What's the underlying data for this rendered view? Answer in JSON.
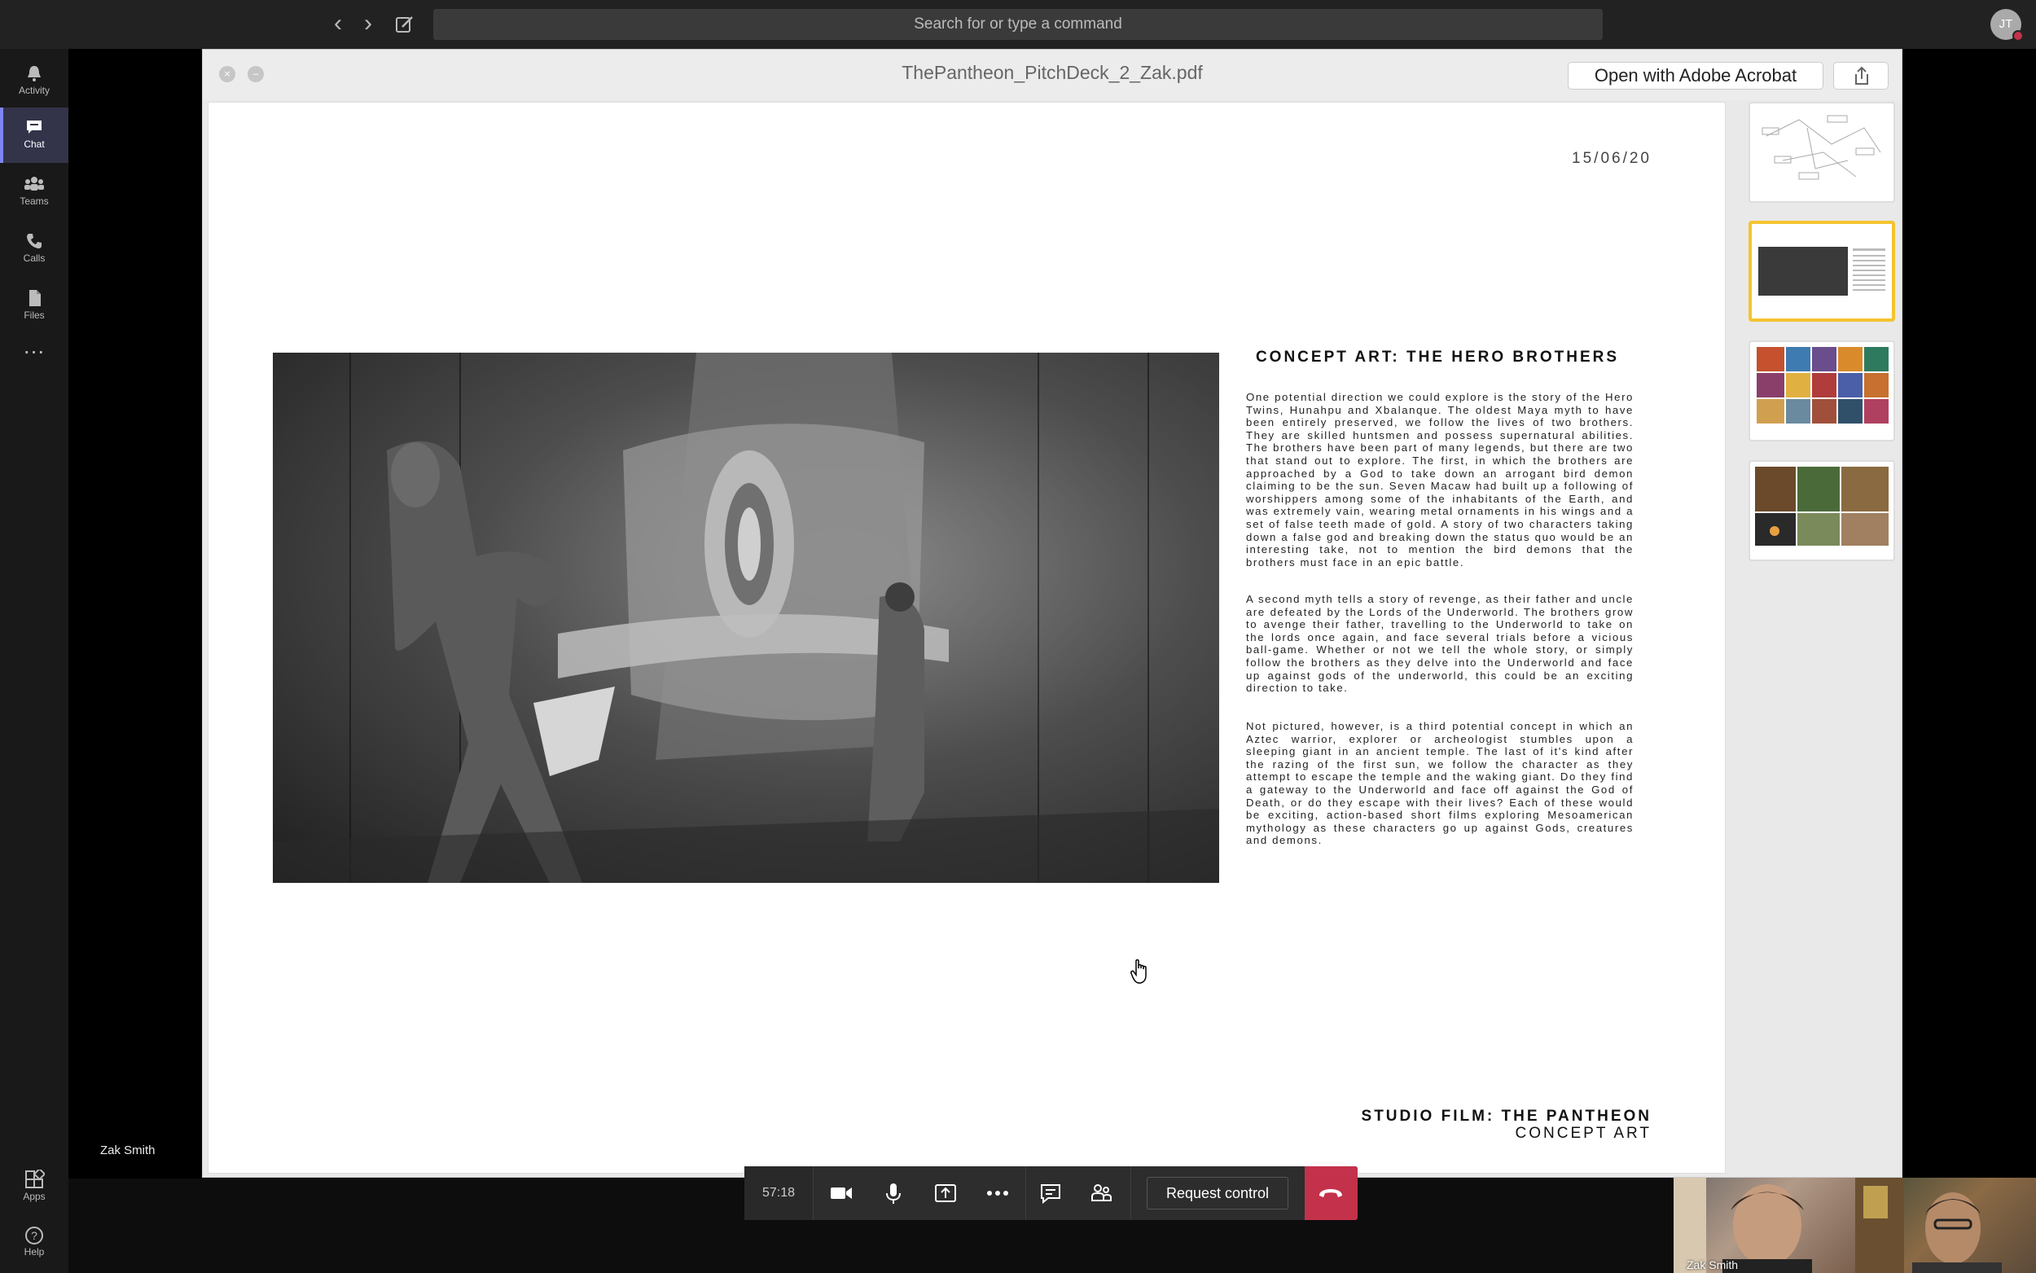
{
  "topbar": {
    "search_placeholder": "Search for or type a command",
    "user_initials": "JT"
  },
  "rail": {
    "items": [
      {
        "label": "Activity",
        "icon": "bell-icon"
      },
      {
        "label": "Chat",
        "icon": "chat-icon"
      },
      {
        "label": "Teams",
        "icon": "teams-icon"
      },
      {
        "label": "Calls",
        "icon": "phone-icon"
      },
      {
        "label": "Files",
        "icon": "file-icon"
      }
    ],
    "more": "...",
    "apps_label": "Apps",
    "help_label": "Help"
  },
  "viewer": {
    "doc_title": "ThePantheon_PitchDeck_2_Zak.pdf",
    "open_button": "Open with Adobe Acrobat",
    "page": {
      "date": "15/06/20",
      "concept_title": "CONCEPT ART: THE HERO BROTHERS",
      "paragraphs": [
        "One potential direction we could explore is the story of the Hero Twins, Hunahpu and Xbalanque. The oldest Maya myth to have been entirely preserved, we follow the lives of two brothers. They are skilled huntsmen and possess supernatural abilities. The brothers have been part of many legends, but there are two that stand out to explore. The first, in which the brothers are approached by a God to take down an arrogant bird demon claiming to be the sun. Seven Macaw had built up a following of worshippers among some of the inhabitants of the Earth, and was extremely vain, wearing metal ornaments in his wings and a set of false teeth made of gold. A story of two characters taking down a false god and breaking down the status quo would be an interesting take, not to mention the bird demons that the brothers must face in an epic battle.",
        "A second myth tells a story of revenge, as their father and uncle are defeated by the Lords of the Underworld. The brothers grow to avenge their father, travelling to the Underworld to take on the lords once again, and face several trials before a vicious ball-game. Whether or not we tell the whole story, or simply follow the brothers as they delve into the Underworld and face up against gods of the underworld, this could be an exciting direction to take.",
        "Not pictured, however, is a third potential concept in which an Aztec warrior, explorer or archeologist stumbles upon a sleeping giant in an ancient temple. The last of it's kind after the razing of the first sun, we follow the character as they attempt to escape the temple and the waking giant. Do they find a gateway to the Underworld and face off against the God of Death, or do they escape with their lives? Each of these would be exciting, action-based short films exploring Mesoamerican mythology as these characters go up against Gods, creatures and demons."
      ],
      "footer_title": "STUDIO FILM: THE PANTHEON",
      "footer_subtitle": "CONCEPT ART"
    },
    "selected_thumbnail": 2
  },
  "presenter_name": "Zak Smith",
  "callbar": {
    "timer": "57:18",
    "request_control": "Request control"
  },
  "videos": [
    {
      "name": "Zak Smith"
    },
    {
      "name": ""
    }
  ],
  "colors": {
    "accent": "#7f85f5",
    "hangup": "#c4314b",
    "thumb_selected": "#f4c430"
  }
}
